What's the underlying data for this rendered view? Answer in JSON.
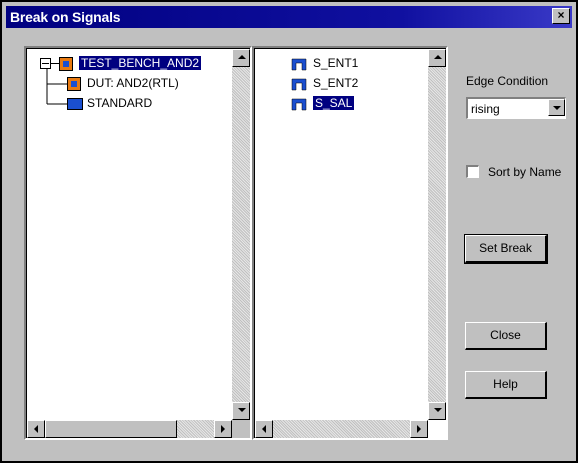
{
  "window": {
    "title": "Break on Signals",
    "close_glyph": "×"
  },
  "tree": {
    "items": [
      {
        "label": "TEST_BENCH_AND2",
        "expander": "⊟",
        "selected": true
      },
      {
        "label": "DUT: AND2(RTL)"
      },
      {
        "label": "STANDARD"
      }
    ]
  },
  "signals": {
    "items": [
      {
        "label": "S_ENT1"
      },
      {
        "label": "S_ENT2"
      },
      {
        "label": "S_SAL",
        "selected": true
      }
    ]
  },
  "edge": {
    "label": "Edge Condition",
    "value": "rising"
  },
  "sort": {
    "label": "Sort by Name",
    "checked": false
  },
  "buttons": {
    "set_break": "Set Break",
    "close": "Close",
    "help": "Help"
  },
  "colors": {
    "selection": "#000080",
    "title_bar": "#000080",
    "face": "#c0c0c0",
    "icon_orange": "#e87a10",
    "icon_blue": "#1a4fd0"
  }
}
